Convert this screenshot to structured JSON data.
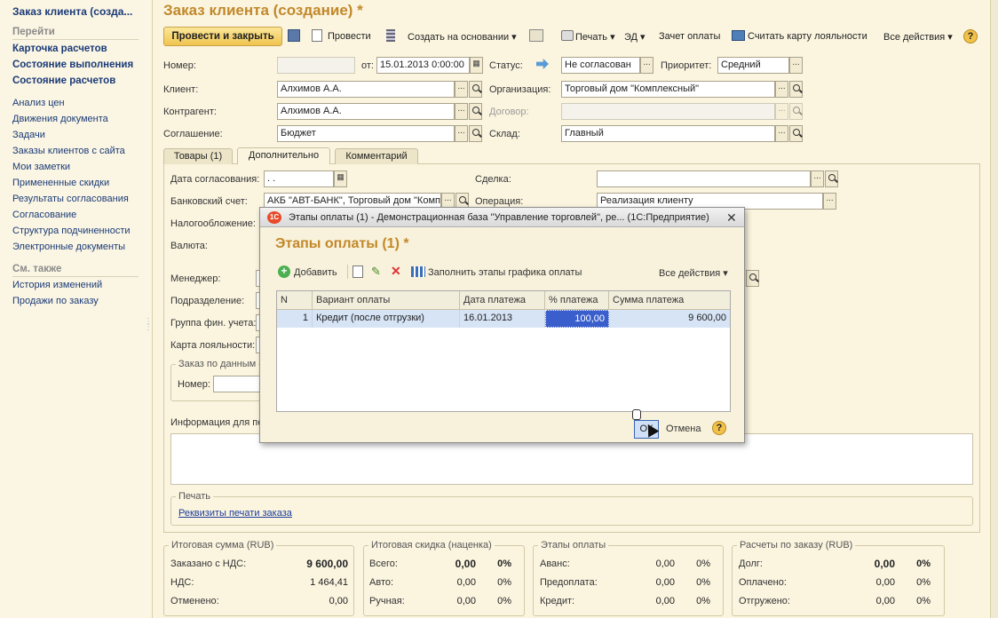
{
  "sidebar": {
    "title": "Заказ клиента (созда...",
    "go_header": "Перейти",
    "bold_links": [
      "Карточка расчетов",
      "Состояние выполнения",
      "Состояние расчетов"
    ],
    "links": [
      "Анализ цен",
      "Движения документа",
      "Задачи",
      "Заказы клиентов с сайта",
      "Мои заметки",
      "Примененные скидки",
      "Результаты согласования",
      "Согласование",
      "Структура подчиненности",
      "Электронные документы"
    ],
    "see_also_header": "См. также",
    "see_also": [
      "История изменений",
      "Продажи по заказу"
    ]
  },
  "header": {
    "title": "Заказ клиента (создание) *"
  },
  "toolbar": {
    "post_close": "Провести и закрыть",
    "post": "Провести",
    "create_based": "Создать на основании ▾",
    "print": "Печать ▾",
    "ed": "ЭД ▾",
    "payment_offset": "Зачет оплаты",
    "loyalty": "Считать карту лояльности",
    "all_actions": "Все действия ▾",
    "help": "?"
  },
  "form": {
    "number_label": "Номер:",
    "number_value": "",
    "from_label": "от:",
    "date_value": "15.01.2013  0:00:00",
    "status_label": "Статус:",
    "status_value": "Не согласован",
    "priority_label": "Приоритет:",
    "priority_value": "Средний",
    "client_label": "Клиент:",
    "client_value": "Алхимов А.А.",
    "org_label": "Организация:",
    "org_value": "Торговый дом \"Комплексный\"",
    "contractor_label": "Контрагент:",
    "contractor_value": "Алхимов А.А.",
    "contract_label": "Договор:",
    "contract_value": "",
    "agreement_label": "Соглашение:",
    "agreement_value": "Бюджет",
    "warehouse_label": "Склад:",
    "warehouse_value": "Главный"
  },
  "tabs": [
    "Товары (1)",
    "Дополнительно",
    "Комментарий"
  ],
  "extra": {
    "approval_date_label": "Дата согласования:",
    "approval_date_value": " .  .",
    "deal_label": "Сделка:",
    "deal_value": "",
    "bank_label": "Банковский счет:",
    "bank_value": "АКБ \"АВТ-БАНК\", Торговый дом \"Комп",
    "operation_label": "Операция:",
    "operation_value": "Реализация клиенту",
    "tax_label": "Налогообложение:",
    "currency_label": "Валюта:",
    "manager_label": "Менеджер:",
    "division_label": "Подразделение:",
    "fin_group_label": "Группа фин. учета:",
    "loyalty_card_label": "Карта лояльности:",
    "order_data_group": "Заказ по данным",
    "number2_label": "Номер:",
    "info_label": "Информация для пе",
    "print_group": "Печать",
    "print_link": "Реквизиты печати заказа"
  },
  "totals": {
    "sum_title": "Итоговая сумма (RUB)",
    "ordered_label": "Заказано с НДС:",
    "ordered_value": "9 600,00",
    "vat_label": "НДС:",
    "vat_value": "1 464,41",
    "cancelled_label": "Отменено:",
    "cancelled_value": "0,00",
    "discount_title": "Итоговая скидка (наценка)",
    "total_label": "Всего:",
    "total_value": "0,00",
    "total_pct": "0%",
    "auto_label": "Авто:",
    "auto_value": "0,00",
    "auto_pct": "0%",
    "manual_label": "Ручная:",
    "manual_value": "0,00",
    "manual_pct": "0%",
    "stages_title": "Этапы оплаты",
    "advance_label": "Аванс:",
    "advance_value": "0,00",
    "advance_pct": "0%",
    "prepay_label": "Предоплата:",
    "prepay_value": "0,00",
    "prepay_pct": "0%",
    "credit_label": "Кредит:",
    "credit_value": "0,00",
    "credit_pct": "0%",
    "settle_title": "Расчеты по заказу (RUB)",
    "debt_label": "Долг:",
    "debt_value": "0,00",
    "debt_pct": "0%",
    "paid_label": "Оплачено:",
    "paid_value": "0,00",
    "paid_pct": "0%",
    "shipped_label": "Отгружено:",
    "shipped_value": "0,00",
    "shipped_pct": "0%"
  },
  "dialog": {
    "window_title": "Этапы оплаты (1) - Демонстрационная база \"Управление торговлей\", ре...  (1С:Предприятие)",
    "logo": "1С",
    "heading": "Этапы оплаты (1) *",
    "add": "Добавить",
    "fill": "Заполнить этапы графика оплаты",
    "all_actions": "Все действия ▾",
    "columns": [
      "N",
      "Вариант оплаты",
      "Дата платежа",
      "% платежа",
      "Сумма платежа"
    ],
    "rows": [
      {
        "n": "1",
        "variant": "Кредит (после отгрузки)",
        "date": "16.01.2013",
        "pct": "100,00",
        "sum": "9 600,00"
      }
    ],
    "ok": "ОК",
    "cancel": "Отмена",
    "help": "?"
  }
}
